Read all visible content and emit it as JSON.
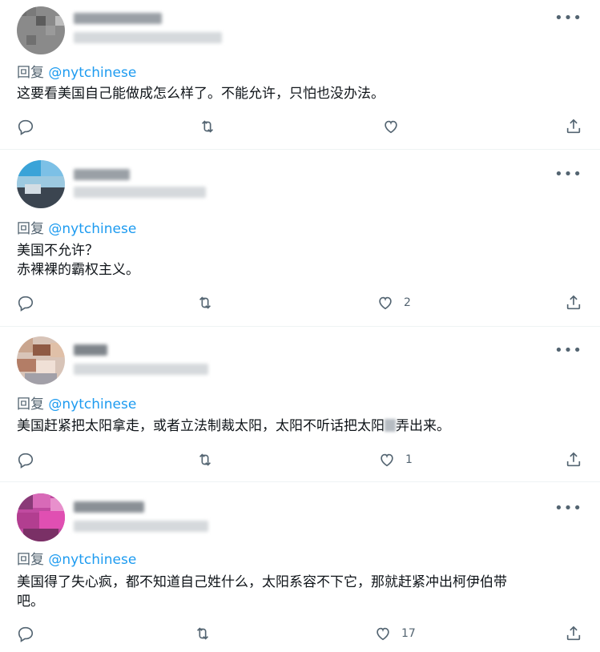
{
  "reply_prefix": "回复",
  "replies": [
    {
      "handle": "@nytchinese",
      "text": "这要看美国自己能做成怎么样了。不能允许，只怕也没办法。",
      "text_after": "",
      "likes": ""
    },
    {
      "handle": "@nytchinese",
      "text": "美国不允许？\n赤裸裸的霸权主义。",
      "text_after": "",
      "likes": "2"
    },
    {
      "handle": "@nytchinese",
      "text": "美国赶紧把太阳拿走，或者立法制裁太阳，太阳不听话把太阳",
      "text_after": "弄出来。",
      "likes": "1"
    },
    {
      "handle": "@nytchinese",
      "text": "美国得了失心疯，都不知道自己姓什么，太阳系容不下它，那就赶紧冲出柯伊伯带\n吧。",
      "text_after": "",
      "likes": "17"
    }
  ],
  "colors": {
    "accent": "#1d9bf0",
    "muted": "#536471",
    "text": "#0f1419"
  }
}
